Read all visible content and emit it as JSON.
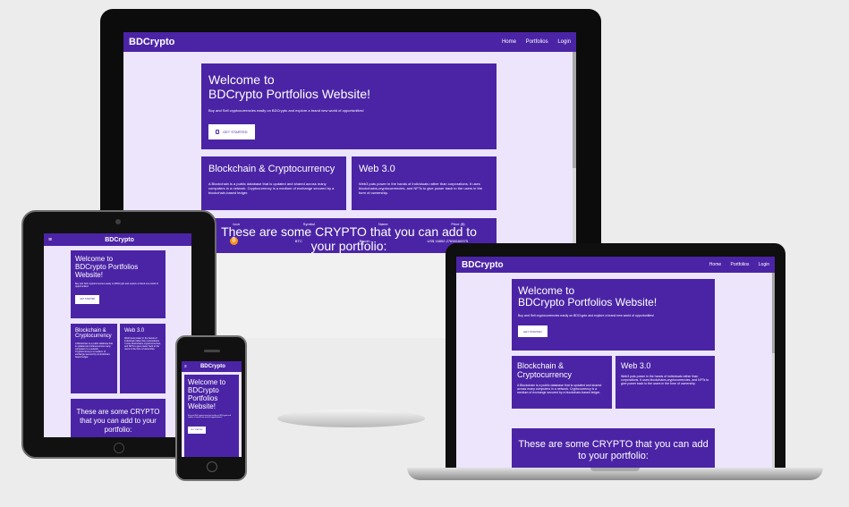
{
  "site": {
    "brand": "BDCrypto",
    "nav_links": [
      "Home",
      "Portfolios",
      "Login"
    ],
    "menu_icon": "hamburger-icon",
    "hero": {
      "line1": "Welcome to",
      "line2": "BDCrypto Portfolios Website!",
      "text": "Buy and Sell cryptocurrencies easily on BDCrypto and explore a brand new world of opportunities!",
      "button": "GET STARTED",
      "button_icon": "document-icon"
    },
    "cards": [
      {
        "title": "Blockchain & Cryptocurrency",
        "text": "A Blockchain is a public database that is updated and shared across many computers in a network. Cryptocurrency is a medium of exchange secured by a blockchain-based ledger."
      },
      {
        "title": "Web 3.0",
        "text": "Web3 puts power in the hands of individuals rather than corporations. It uses blockchains,cryptocurrencies, and NFTs to give power back to the users in the form of ownership."
      }
    ],
    "list_heading": "These are some CRYPTO that you can add to your portfolio:",
    "table": {
      "headers": [
        "Icon",
        "Symbol",
        "Name",
        "Price ($)"
      ],
      "rows": [
        {
          "icon": "bitcoin-icon",
          "symbol": "BTC",
          "name": "Bitcoin",
          "price": "US$ 16852.27658160975"
        }
      ]
    }
  },
  "colors": {
    "primary": "#4b24a6",
    "page_bg": "#ece5fb",
    "bitcoin": "#f7931a"
  }
}
